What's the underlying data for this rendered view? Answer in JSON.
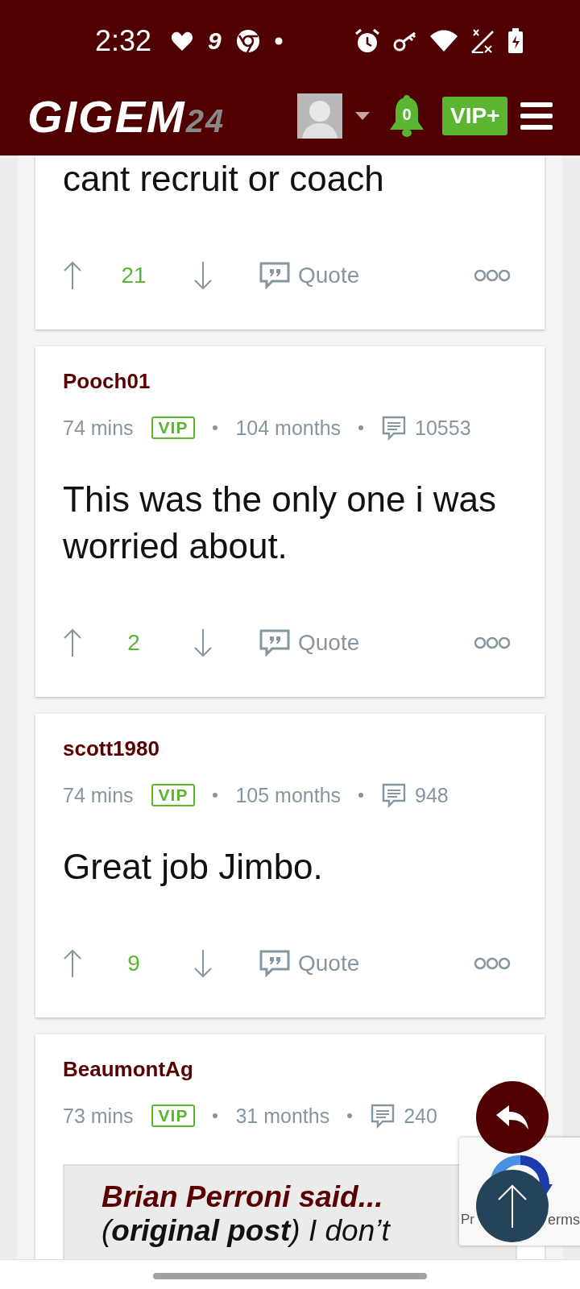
{
  "status_bar": {
    "time": "2:32",
    "app_badge": "9"
  },
  "header": {
    "logo": "GIGEM",
    "logo_suffix": "24",
    "notification_count": "0",
    "vip_button": "VIP+"
  },
  "posts": [
    {
      "body": "cant recruit or coach",
      "upvotes": "21",
      "quote_label": "Quote"
    },
    {
      "username": "Pooch01",
      "time": "74 mins",
      "badge": "VIP",
      "tenure": "104 months",
      "post_count": "10553",
      "body": "This was the only one i was worried about.",
      "upvotes": "2",
      "quote_label": "Quote"
    },
    {
      "username": "scott1980",
      "time": "74 mins",
      "badge": "VIP",
      "tenure": "105 months",
      "post_count": "948",
      "body": "Great job Jimbo.",
      "upvotes": "9",
      "quote_label": "Quote"
    },
    {
      "username": "BeaumontAg",
      "time": "73 mins",
      "badge": "VIP",
      "tenure": "31 months",
      "post_count": "240",
      "quote": {
        "author_line": "Brian Perroni said...",
        "text": "(**original post**) I don’t"
      }
    }
  ],
  "recaptcha": {
    "left_text": "Pr",
    "right_text": "erms"
  }
}
